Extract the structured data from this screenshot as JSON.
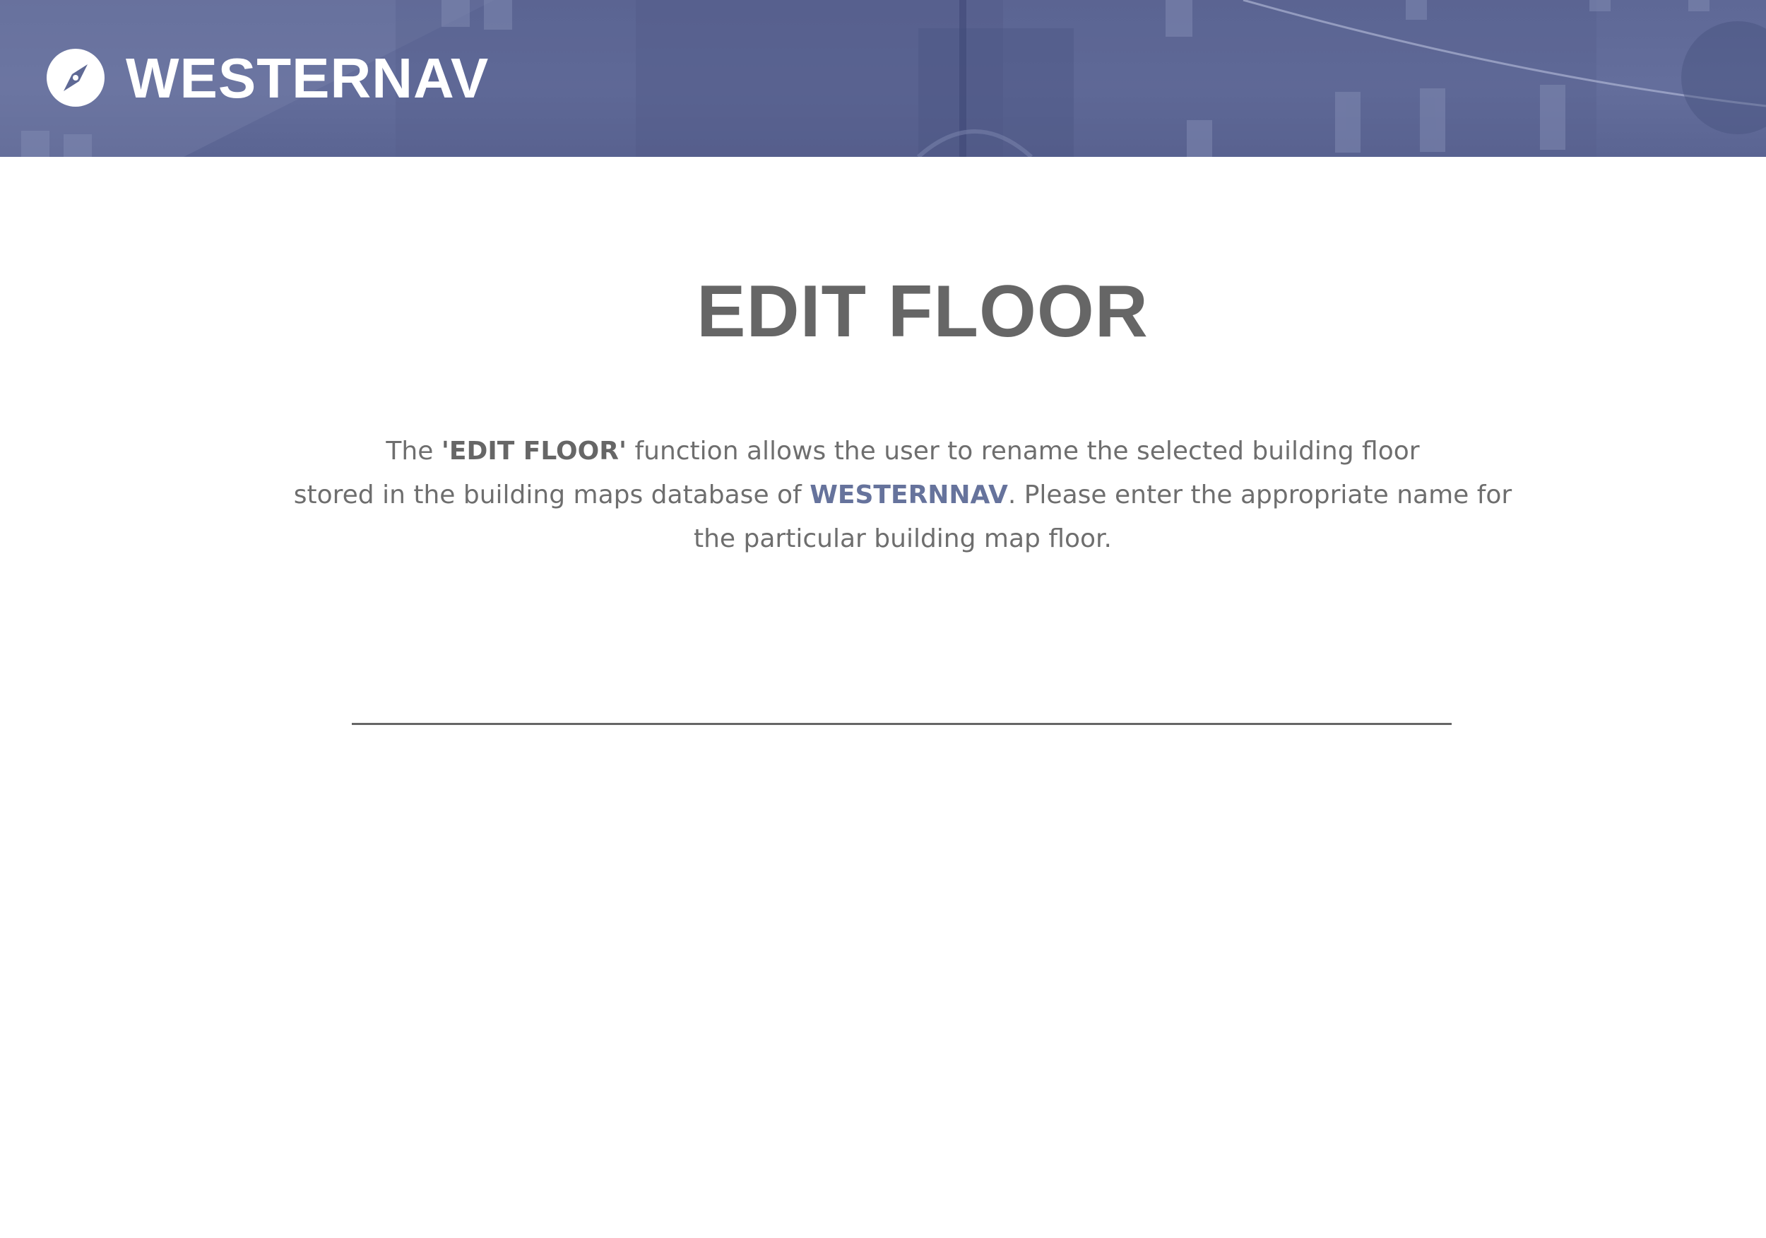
{
  "header": {
    "brand_name": "WESTERNAV",
    "logo_icon": "compass-icon",
    "background_color": "#5f6995"
  },
  "main": {
    "title": "EDIT FLOOR",
    "description": {
      "line1_pre": "The ",
      "line1_bold": "'EDIT FLOOR'",
      "line1_post": " function allows the user to rename the selected building floor",
      "line2_pre": "stored in the building maps database of ",
      "line2_brand": "WESTERNNAV",
      "line2_post": ". Please enter the appropriate name for",
      "line3": "the particular building map floor."
    },
    "floor_name_input": {
      "value": "",
      "placeholder": ""
    }
  },
  "colors": {
    "title": "#666666",
    "text": "#6e6e6e",
    "brand_accent": "#66739c",
    "underline": "#666666"
  }
}
